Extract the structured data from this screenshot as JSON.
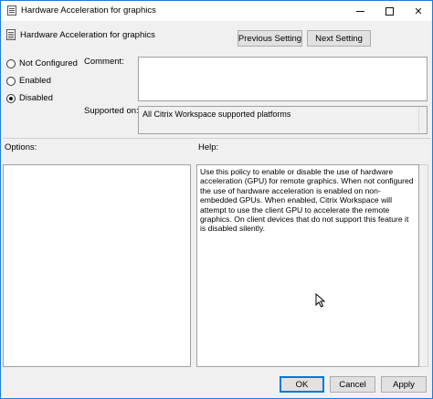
{
  "window": {
    "title": "Hardware Acceleration for graphics",
    "controls": {
      "minimize": "",
      "maximize": "",
      "close": "✕"
    }
  },
  "header": {
    "title": "Hardware Acceleration for graphics",
    "prev_label": "Previous Setting",
    "next_label": "Next Setting"
  },
  "state": {
    "options": [
      {
        "label": "Not Configured",
        "checked": false
      },
      {
        "label": "Enabled",
        "checked": false
      },
      {
        "label": "Disabled",
        "checked": true
      }
    ]
  },
  "comment": {
    "label": "Comment:",
    "value": ""
  },
  "supported": {
    "label": "Supported on:",
    "value": "All Citrix Workspace supported platforms"
  },
  "options_label": "Options:",
  "help": {
    "label": "Help:",
    "text": "Use this policy to enable or disable the use of hardware acceleration (GPU) for remote graphics. When not configured the use of hardware acceleration is enabled on non-embedded GPUs. When enabled, Citrix Workspace will attempt to use the client GPU to accelerate the remote graphics. On client devices that do not support this feature it is disabled silently."
  },
  "footer": {
    "ok": "OK",
    "cancel": "Cancel",
    "apply": "Apply"
  },
  "icons": {
    "title": "policy-document-icon",
    "header": "policy-document-icon",
    "cursor": "mouse-pointer-icon"
  }
}
